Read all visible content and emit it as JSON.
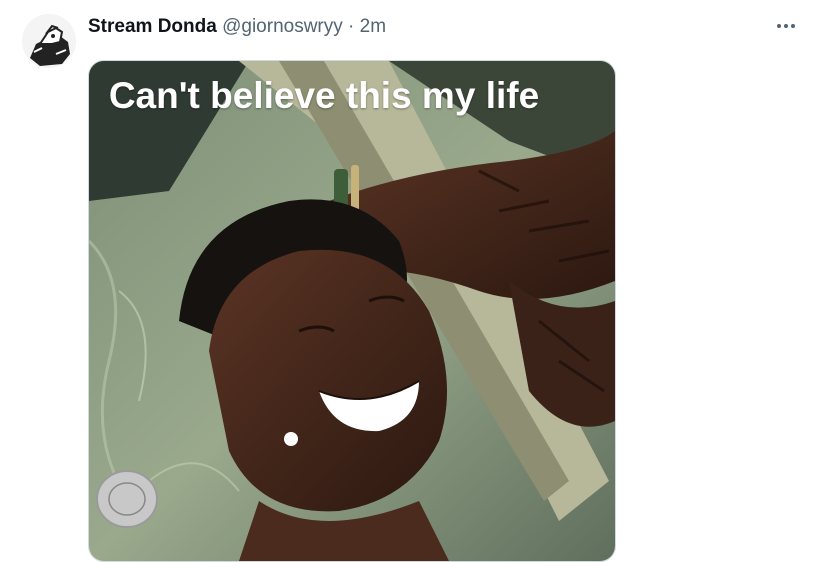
{
  "tweet": {
    "display_name": "Stream Donda",
    "handle": "@giornoswryy",
    "separator": "·",
    "timestamp": "2m",
    "more_icon": "more-horizontal-icon",
    "media": {
      "caption": "Can't believe this my life"
    }
  },
  "colors": {
    "text_primary": "#0f1419",
    "text_secondary": "#536471",
    "media_border": "#cfd9de"
  }
}
